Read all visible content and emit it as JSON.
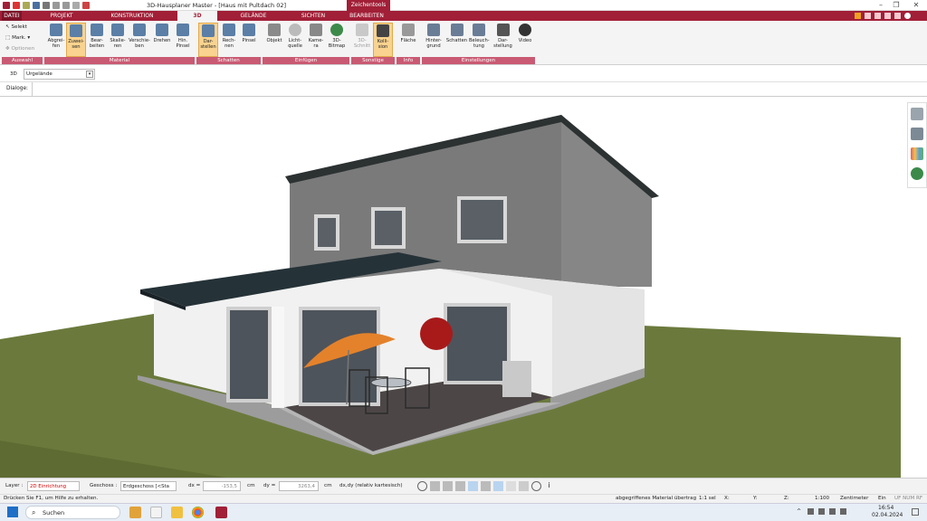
{
  "app": {
    "title": "3D-Hausplaner Master - [Haus mit Pultdach 02]",
    "context_tab": "Zeichentools"
  },
  "ribbon": {
    "tabs": [
      "DATEI",
      "PROJEKT",
      "KONSTRUKTION",
      "3D",
      "GELÄNDE",
      "SICHTEN",
      "BEARBEITEN"
    ],
    "active_tab": "3D",
    "selection": {
      "select": "Selekt",
      "mark": "Mark.",
      "options": "Optionen"
    },
    "buttons": [
      {
        "label": "Abgrei-\nfen",
        "icon": "eyedropper-icon"
      },
      {
        "label": "Zuwei-\nsen",
        "icon": "paint-assign-icon"
      },
      {
        "label": "Bear-\nbeiten",
        "icon": "edit-material-icon"
      },
      {
        "label": "Skalie-\nren",
        "icon": "scale-icon"
      },
      {
        "label": "Verschie-\nben",
        "icon": "move-icon"
      },
      {
        "label": "Drehen",
        "icon": "rotate-icon"
      },
      {
        "label": "Hin.\nPinsel",
        "icon": "brush-icon"
      },
      {
        "label": "Dar-\nstellen",
        "icon": "shadow-display-icon"
      },
      {
        "label": "Rech-\nnen",
        "icon": "calculate-icon"
      },
      {
        "label": "Pinsel",
        "icon": "brush-icon"
      },
      {
        "label": "Objekt",
        "icon": "chair-icon"
      },
      {
        "label": "Licht-\nquelle",
        "icon": "lightbulb-icon"
      },
      {
        "label": "Kame-\nra",
        "icon": "camera-icon"
      },
      {
        "label": "3D-\nBitmap",
        "icon": "tree-icon"
      },
      {
        "label": "3D-\nSchnitt",
        "icon": "section-icon"
      },
      {
        "label": "Kolli-\nsion",
        "icon": "collision-icon"
      },
      {
        "label": "Fläche",
        "icon": "area-icon"
      },
      {
        "label": "Hinter-\ngrund",
        "icon": "house-icon"
      },
      {
        "label": "Schatten",
        "icon": "house-shadow-icon"
      },
      {
        "label": "Beleuch-\ntung",
        "icon": "house-light-icon"
      },
      {
        "label": "Dar-\nstellung",
        "icon": "monitor-icon"
      },
      {
        "label": "Video",
        "icon": "play-icon"
      }
    ],
    "groups": [
      "Auswahl",
      "Material",
      "Schatten",
      "Einfügen",
      "Sonstige",
      "Info",
      "Einstellungen"
    ]
  },
  "layer_bar": {
    "mode": "3D",
    "layer_name": "Urgelände"
  },
  "dialog_bar": {
    "label": "Dialoge:"
  },
  "status": {
    "layer_label": "Layer :",
    "layer_value": "2D Einrichtung",
    "floor_label": "Geschoss :",
    "floor_value": "Erdgeschoss [<Sta",
    "dx_label": "dx =",
    "dx_value": "-153,5",
    "dx_unit": "cm",
    "dy_label": "dy =",
    "dy_value": "3263,4",
    "dy_unit": "cm",
    "coord_mode": "dx,dy (relativ kartesisch)"
  },
  "hint": {
    "left": "Drücken Sie F1, um Hilfe zu erhalten.",
    "material": "abgegriffenes Material übertrag",
    "scale_short": "1:1 sel",
    "x": "X:",
    "y": "Y:",
    "z": "Z:",
    "scale": "1:100",
    "unit": "Zentimeter",
    "state": "Ein",
    "flags": "UF NUM RF"
  },
  "taskbar": {
    "search_placeholder": "Suchen",
    "time": "16:54",
    "date": "02.04.2024"
  },
  "colors": {
    "brand": "#a11f37",
    "group_bar": "#c95a73",
    "selected_button": "#f9d38f",
    "grass": "#6b7a3c"
  }
}
